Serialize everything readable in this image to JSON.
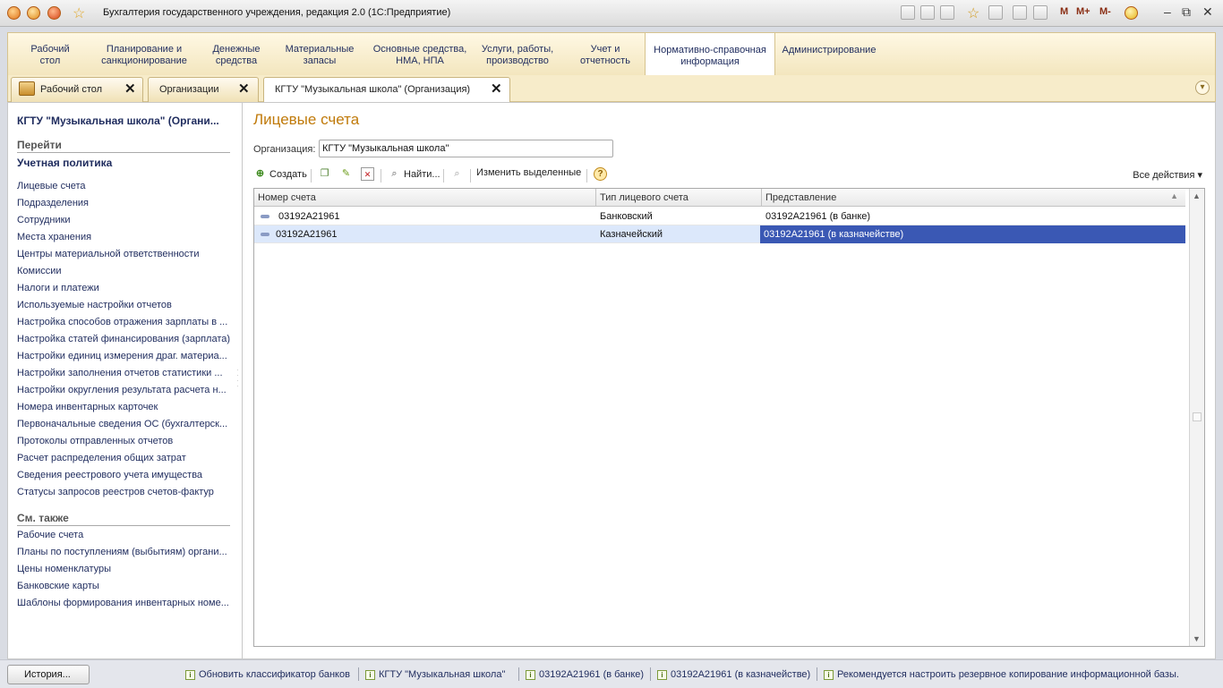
{
  "window": {
    "title": "Бухгалтерия государственного учреждения, редакция 2.0  (1С:Предприятие)",
    "toolbar_texts": [
      "M",
      "M+",
      "M-"
    ]
  },
  "sections": [
    {
      "label": "Рабочий\nстол"
    },
    {
      "label": "Планирование и\nсанкционирование"
    },
    {
      "label": "Денежные\nсредства"
    },
    {
      "label": "Материальные\nзапасы"
    },
    {
      "label": "Основные средства,\nНМА, НПА"
    },
    {
      "label": "Услуги, работы,\nпроизводство"
    },
    {
      "label": "Учет и\nотчетность"
    },
    {
      "label": "Нормативно-справочная\nинформация",
      "active": true
    },
    {
      "label": "Администрирование"
    }
  ],
  "tabs": [
    {
      "label": "Рабочий стол"
    },
    {
      "label": "Организации"
    },
    {
      "label": "КГТУ \"Музыкальная школа\" (Организация)",
      "active": true
    }
  ],
  "left": {
    "org_title": "КГТУ \"Музыкальная школа\" (Органи...",
    "goto_title": "Перейти",
    "policy": "Учетная политика",
    "goto_links": [
      "Лицевые счета",
      "Подразделения",
      "Сотрудники",
      "Места хранения",
      "Центры материальной ответственности",
      "Комиссии",
      "Налоги и платежи",
      "Используемые настройки отчетов",
      "Настройка способов отражения зарплаты в ...",
      "Настройка статей финансирования (зарплата)",
      "Настройки единиц измерения драг. материа...",
      "Настройки заполнения отчетов статистики ...",
      "Настройки округления результата расчета н...",
      "Номера инвентарных карточек",
      "Первоначальные сведения ОС (бухгалтерск...",
      "Протоколы отправленных отчетов",
      "Расчет распределения общих затрат",
      "Сведения реестрового учета имущества",
      "Статусы запросов реестров счетов-фактур"
    ],
    "see_also_title": "См. также",
    "see_also_links": [
      "Рабочие счета",
      "Планы по поступлениям (выбытиям) органи...",
      "Цены номенклатуры",
      "Банковские карты",
      "Шаблоны формирования инвентарных номе..."
    ]
  },
  "form": {
    "title": "Лицевые счета",
    "org_label": "Организация:",
    "org_value": "КГТУ \"Музыкальная школа\"",
    "toolbar": {
      "create": "Создать",
      "find": "Найти...",
      "change_selected": "Изменить выделенные",
      "help": "?",
      "all_actions": "Все действия ▾"
    },
    "columns": [
      "Номер счета",
      "Тип лицевого счета",
      "Представление"
    ],
    "rows": [
      {
        "number": "03192A21961",
        "type": "Банковский",
        "view": "03192A21961 (в банке)"
      },
      {
        "number": "03192A21961",
        "type": "Казначейский",
        "view": "03192A21961 (в казначействе)"
      }
    ]
  },
  "status": {
    "history_button": "История...",
    "messages": [
      "Обновить классификатор банков",
      "КГТУ \"Музыкальная школа\"",
      "03192A21961 (в банке)",
      "03192A21961 (в казначействе)",
      "Рекомендуется настроить резервное копирование информационной базы."
    ]
  },
  "colors": {
    "accent": "#c07a0a",
    "link": "#1f2c5e",
    "selection": "#3a58b4"
  }
}
